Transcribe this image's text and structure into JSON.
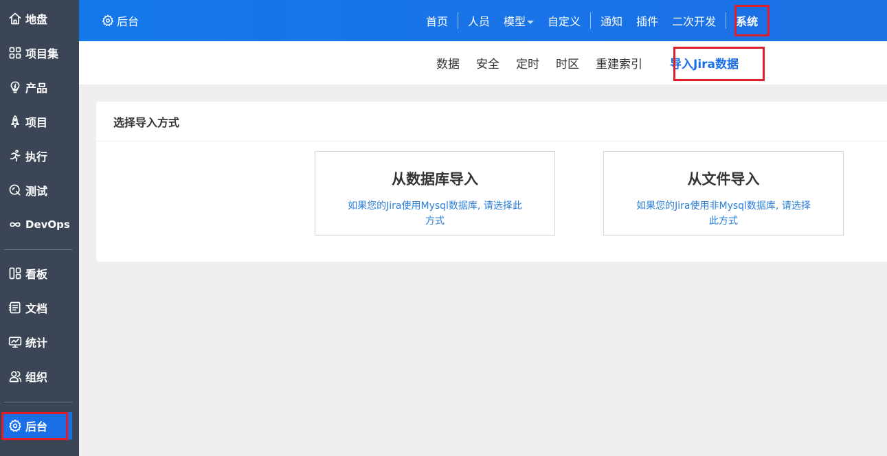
{
  "sidebar": {
    "items": [
      {
        "label": "地盘",
        "icon": "home-icon"
      },
      {
        "label": "项目集",
        "icon": "grid-icon"
      },
      {
        "label": "产品",
        "icon": "bulb-icon"
      },
      {
        "label": "项目",
        "icon": "rocket-icon"
      },
      {
        "label": "执行",
        "icon": "run-icon"
      },
      {
        "label": "测试",
        "icon": "test-icon"
      },
      {
        "label": "DevOps",
        "icon": "infinity-icon"
      },
      {
        "label": "看板",
        "icon": "kanban-icon"
      },
      {
        "label": "文档",
        "icon": "doc-icon"
      },
      {
        "label": "统计",
        "icon": "monitor-icon"
      },
      {
        "label": "组织",
        "icon": "users-icon"
      }
    ],
    "admin": {
      "label": "后台",
      "icon": "gear-icon"
    }
  },
  "topbar": {
    "brand": "后台",
    "nav": [
      "首页",
      "人员",
      "模型",
      "自定义",
      "通知",
      "插件",
      "二次开发",
      "系统"
    ]
  },
  "subnav": {
    "items": [
      "数据",
      "安全",
      "定时",
      "时区",
      "重建索引",
      "导入Jira数据"
    ]
  },
  "panel": {
    "title": "选择导入方式",
    "cards": [
      {
        "title": "从数据库导入",
        "desc": "如果您的Jira使用Mysql数据库, 请选择此方式"
      },
      {
        "title": "从文件导入",
        "desc": "如果您的Jira使用非Mysql数据库, 请选择此方式"
      }
    ]
  },
  "colors": {
    "accent": "#1a6fe6",
    "sidebar": "#3b4556",
    "highlight": "#e01e2b"
  }
}
